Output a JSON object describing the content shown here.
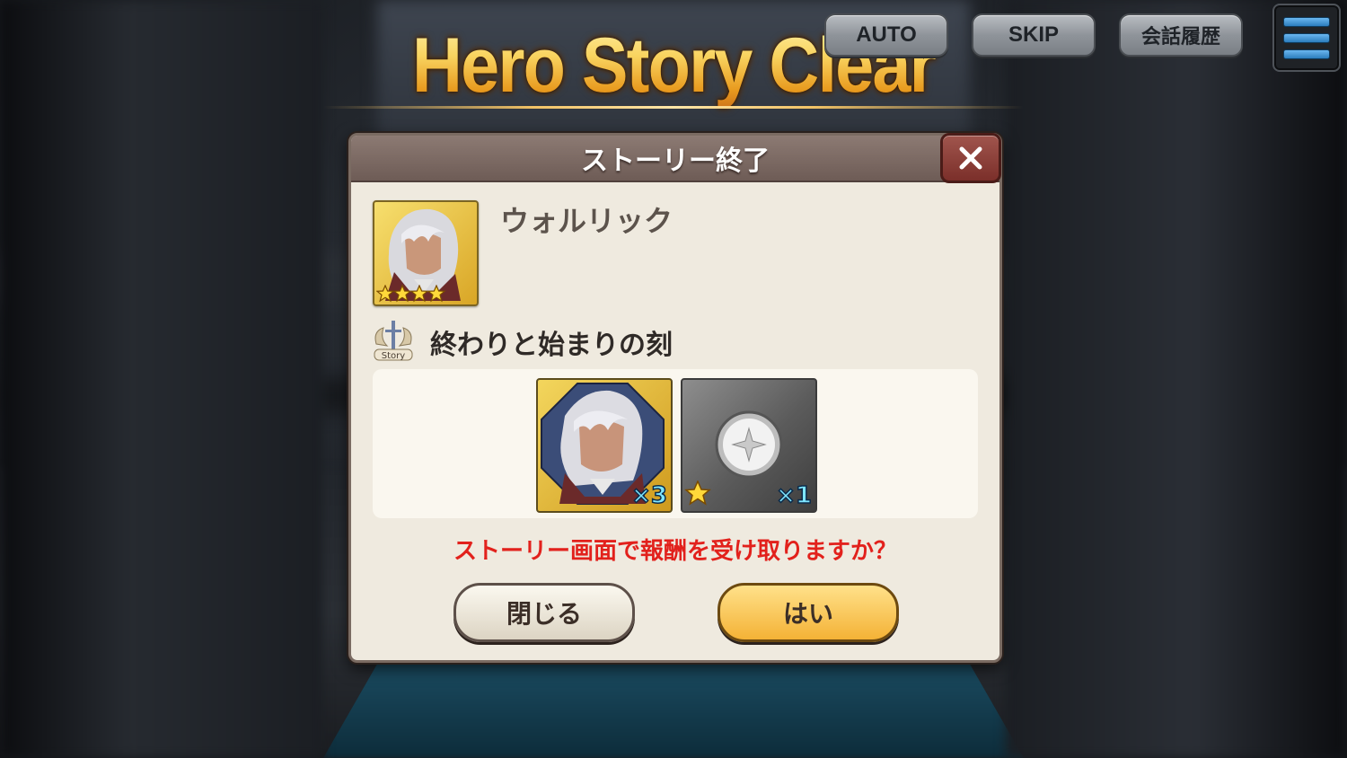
{
  "title": "Hero Story Clear",
  "top_bar": {
    "auto_label": "AUTO",
    "skip_label": "SKIP",
    "log_label": "会話履歴",
    "menu_icon": "hamburger-menu-icon"
  },
  "dialog": {
    "header": "ストーリー終了",
    "close_icon": "close-icon",
    "hero": {
      "name": "ウォルリック",
      "rarity_stars": 4
    },
    "story": {
      "icon_label": "Story",
      "title": "終わりと始まりの刻"
    },
    "rewards": [
      {
        "kind": "hero-shard",
        "quantity": "×3"
      },
      {
        "kind": "crystal",
        "rarity_stars": 1,
        "quantity": "×1"
      }
    ],
    "prompt": "ストーリー画面で報酬を受け取りますか？",
    "close_button": "閉じる",
    "yes_button": "はい"
  },
  "colors": {
    "title_gold": "#f6c74a",
    "prompt_red": "#e2211c",
    "yes_button": "#f4b236",
    "qty_cyan": "#7fe6ff"
  }
}
